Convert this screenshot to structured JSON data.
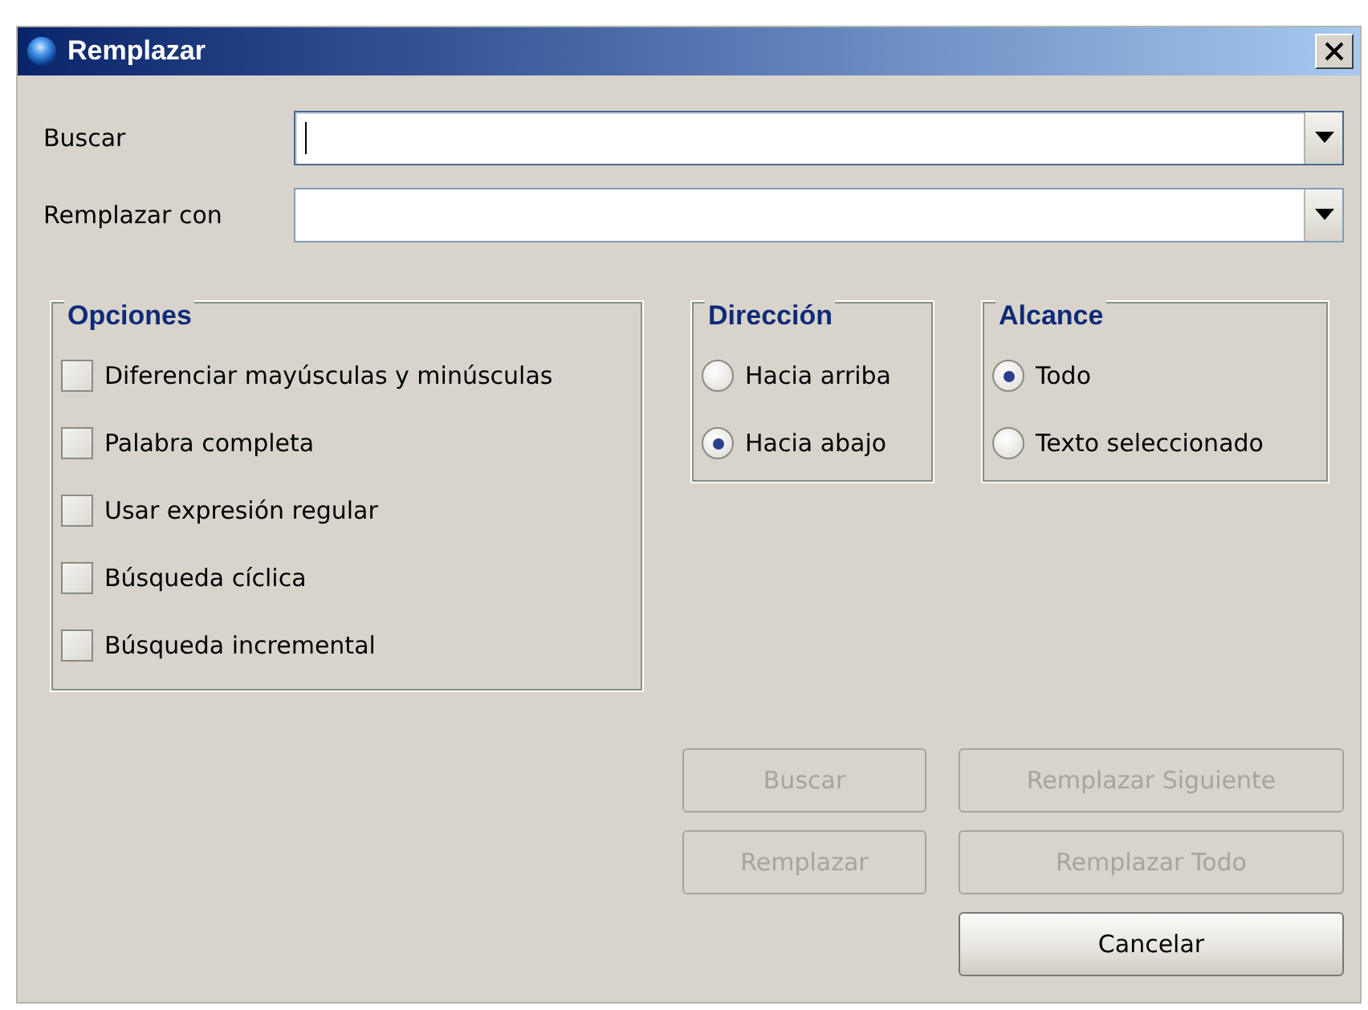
{
  "window": {
    "title": "Remplazar"
  },
  "fields": [
    {
      "label": "Buscar",
      "focused": true
    },
    {
      "label": "Remplazar con",
      "focused": false
    }
  ],
  "options": {
    "title": "Opciones",
    "items": [
      {
        "label": "Diferenciar mayúsculas y minúsculas",
        "checked": false
      },
      {
        "label": "Palabra completa",
        "checked": false
      },
      {
        "label": "Usar expresión regular",
        "checked": false
      },
      {
        "label": "Búsqueda cíclica",
        "checked": false
      },
      {
        "label": "Búsqueda incremental",
        "checked": false
      }
    ]
  },
  "direction": {
    "title": "Dirección",
    "items": [
      {
        "label": "Hacia arriba",
        "selected": false
      },
      {
        "label": "Hacia abajo",
        "selected": true
      }
    ]
  },
  "scope": {
    "title": "Alcance",
    "items": [
      {
        "label": "Todo",
        "selected": true
      },
      {
        "label": "Texto seleccionado",
        "selected": false
      }
    ]
  },
  "buttons": [
    {
      "label": "Buscar",
      "disabled": true
    },
    {
      "label": "Remplazar Siguiente",
      "disabled": true
    },
    {
      "label": "Remplazar",
      "disabled": true
    },
    {
      "label": "Remplazar Todo",
      "disabled": true
    },
    {
      "label": "Cancelar",
      "disabled": false
    }
  ]
}
